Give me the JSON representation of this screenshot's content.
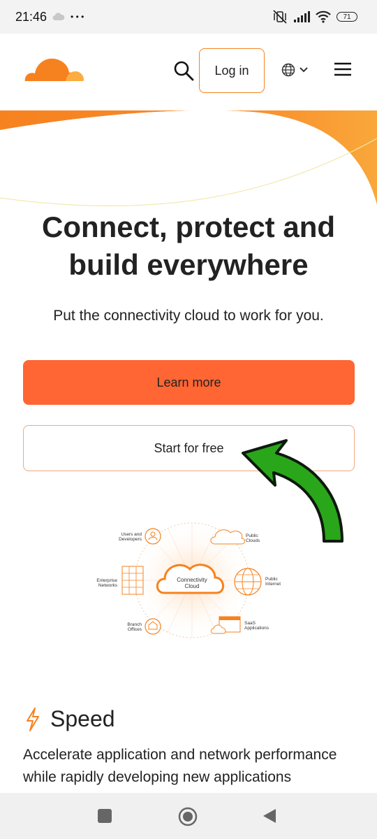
{
  "status_bar": {
    "time": "21:46",
    "notif_dots": "• • •",
    "battery": "71"
  },
  "header": {
    "logo_icon": "cloudflare-logo",
    "search_icon": "search-icon",
    "login_label": "Log in",
    "language_icon": "globe-icon",
    "menu_icon": "menu-icon"
  },
  "hero": {
    "title_line1": "Connect, protect and",
    "title_line2": "build everywhere",
    "subtitle": "Put the connectivity cloud to work for you.",
    "learn_more_label": "Learn more",
    "start_free_label": "Start for free"
  },
  "diagram": {
    "center_line1": "Connectivity",
    "center_line2": "Cloud",
    "users_line1": "Users and",
    "users_line2": "Developers",
    "public_clouds_line1": "Public",
    "public_clouds_line2": "Clouds",
    "enterprise_line1": "Enterprise",
    "enterprise_line2": "Networks",
    "public_internet_line1": "Public",
    "public_internet_line2": "Internet",
    "branch_line1": "Branch",
    "branch_line2": "Offices",
    "saas_line1": "SaaS",
    "saas_line2": "Applications"
  },
  "speed": {
    "icon": "lightning-icon",
    "title": "Speed",
    "description": "Accelerate application and network performance while rapidly developing new applications"
  },
  "colors": {
    "accent": "#f6821f",
    "button": "#ff6633",
    "arrow": "#2aa61a"
  }
}
